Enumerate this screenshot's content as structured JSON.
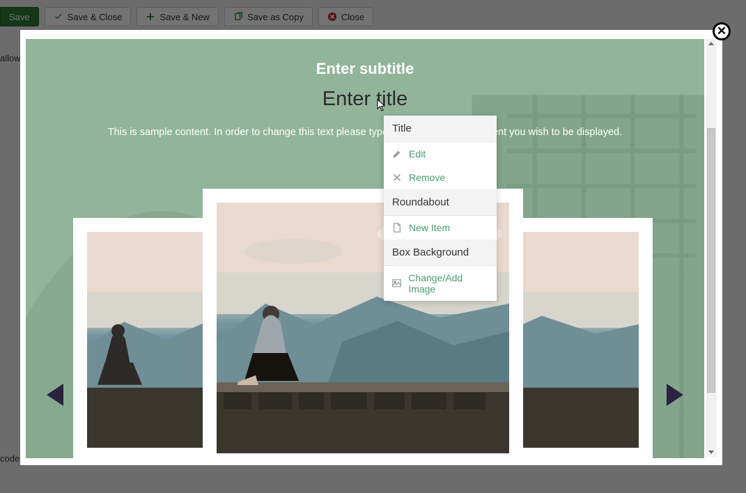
{
  "toolbar": {
    "save": "Save",
    "save_close": "Save & Close",
    "save_new": "Save & New",
    "save_copy": "Save as Copy",
    "close": "Close"
  },
  "background": {
    "allow_label": "allow",
    "code_label": "code"
  },
  "hero": {
    "subtitle": "Enter subtitle",
    "title": "Enter title",
    "sample": "This is sample content. In order to change this text please type in the text box the content you wish to be displayed."
  },
  "context_menu": {
    "section_title": "Title",
    "edit": "Edit",
    "remove": "Remove",
    "section_roundabout": "Roundabout",
    "new_item": "New Item",
    "section_box_bg": "Box Background",
    "change_add_image": "Change/Add Image"
  },
  "icons": {
    "check": "check-icon",
    "plus": "plus-icon",
    "copy": "copy-icon",
    "cancel": "cancel-icon",
    "pencil": "pencil-icon",
    "x": "x-icon",
    "file": "file-icon",
    "image": "image-icon"
  },
  "colors": {
    "accent_green": "#4a9a6f",
    "dark_triangle": "#2a2340",
    "overlay_green": "#6da37e"
  }
}
